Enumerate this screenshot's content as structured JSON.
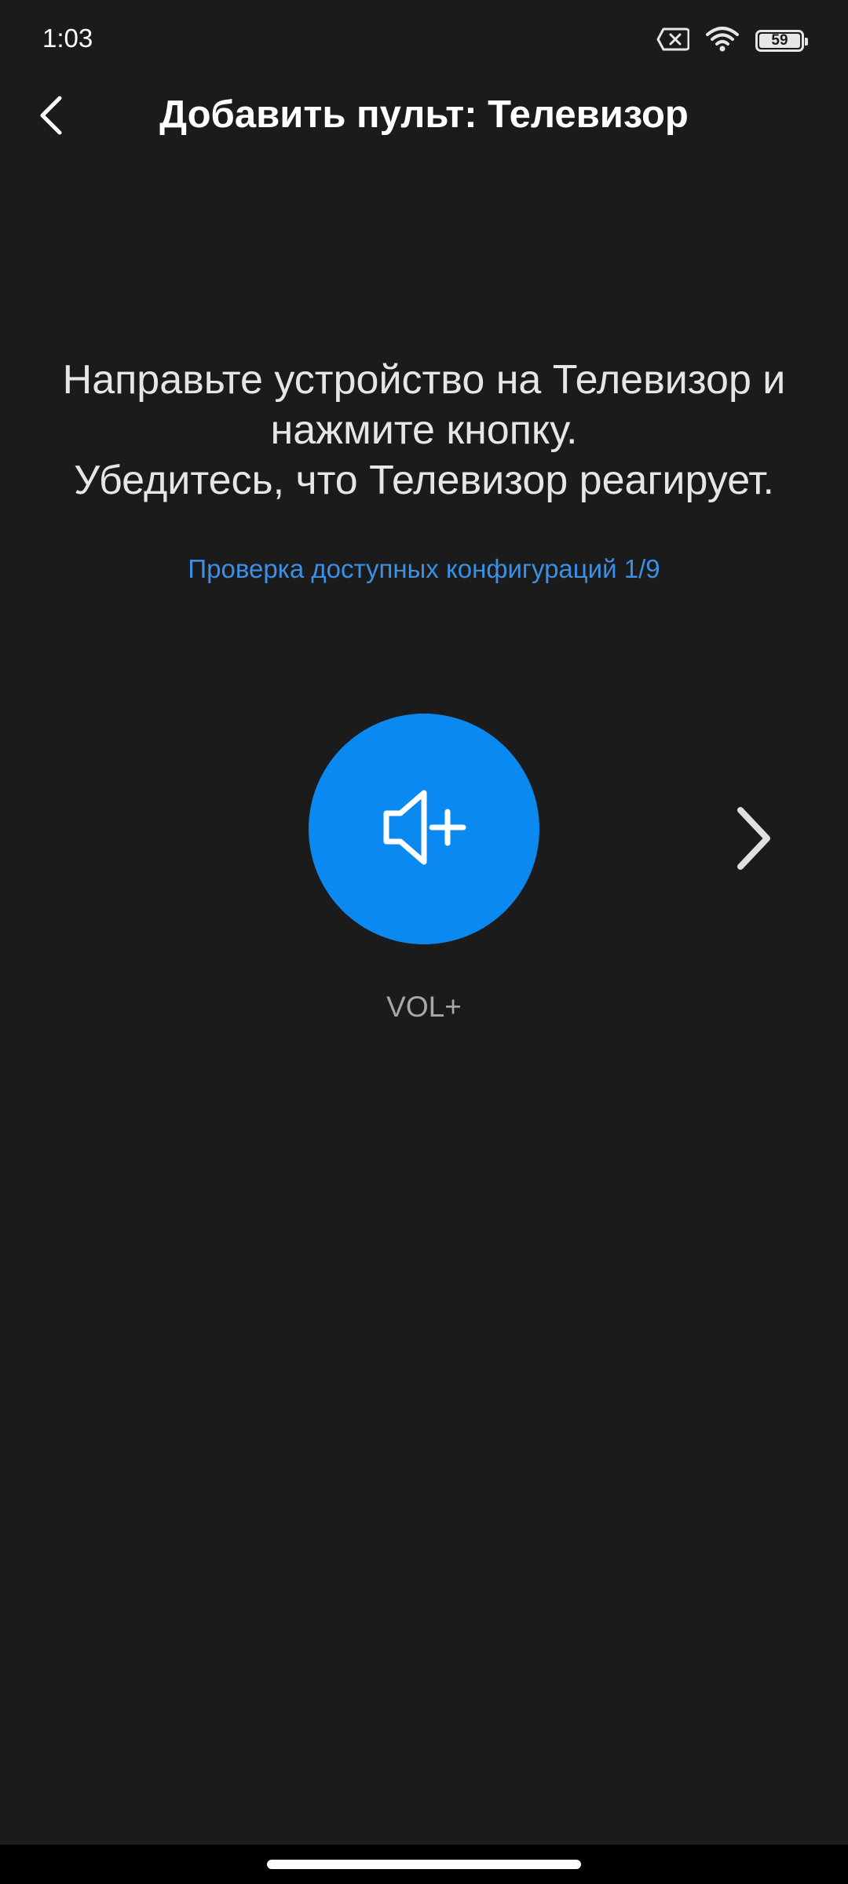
{
  "status_bar": {
    "time": "1:03",
    "battery": "59",
    "icons": [
      "sim-error-icon",
      "wifi-icon",
      "battery-icon"
    ]
  },
  "header": {
    "title": "Добавить пульт: Телевизор"
  },
  "main": {
    "instruction_lines": [
      "Направьте устройство на Телевизор и",
      "нажмите кнопку.",
      "Убедитесь, что Телевизор реагирует."
    ],
    "progress_text": "Проверка доступных конфигураций 1/9",
    "test_button": {
      "icon": "volume-up-icon",
      "label": "VOL+"
    },
    "next_icon": "chevron-right-icon"
  },
  "colors": {
    "background": "#1b1b1b",
    "accent": "#0a8af0",
    "link": "#3a8fe6"
  }
}
